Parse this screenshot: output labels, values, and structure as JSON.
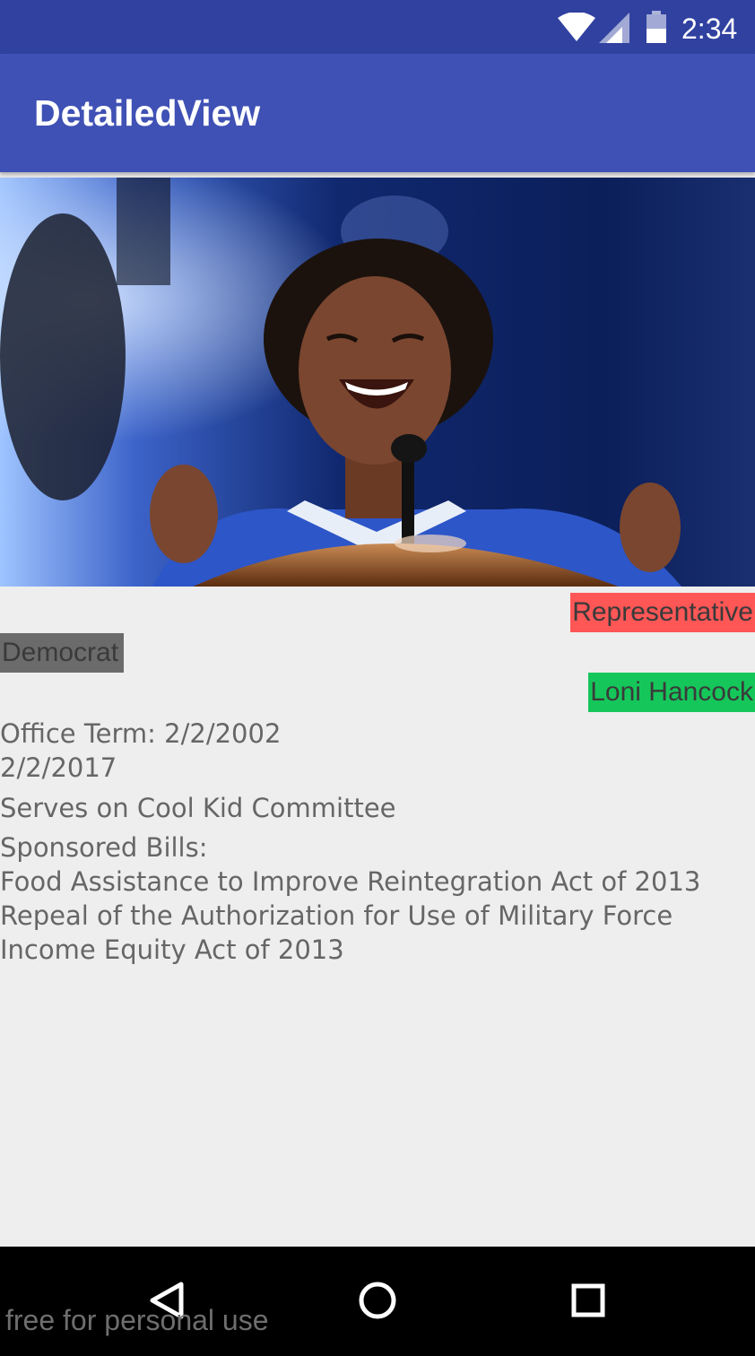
{
  "status_bar": {
    "time": "2:34",
    "icons": [
      "wifi-icon",
      "signal-icon",
      "battery-icon"
    ]
  },
  "app_bar": {
    "title": "DetailedView",
    "background": "#3f51b5",
    "status_background": "#3041a0"
  },
  "profile": {
    "title": "Representative",
    "party": "Democrat",
    "name": "Loni Hancock",
    "term_label": "Office Term: 2/2/2002",
    "term_end": "2/2/2017",
    "committee": "Serves on Cool Kid Committee",
    "bills_label": "Sponsored Bills:",
    "bills": [
      "Food Assistance to Improve Reintegration Act of 2013",
      "Repeal of the Authorization for Use of Military Force",
      "Income Equity Act of 2013"
    ],
    "colors": {
      "title_tag": "#ff5656",
      "party_tag": "#6b6b6b",
      "name_tag": "#15c75a"
    }
  },
  "nav_bar": {
    "buttons": [
      "back-icon",
      "home-icon",
      "recents-icon"
    ]
  },
  "watermark": "free for personal use"
}
